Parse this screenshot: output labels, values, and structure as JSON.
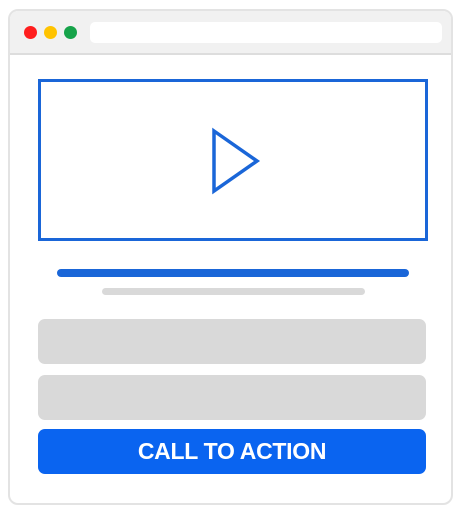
{
  "window": {
    "controls": [
      {
        "name": "close",
        "color": "#ff1e1e"
      },
      {
        "name": "minimize",
        "color": "#ffc300"
      },
      {
        "name": "maximize",
        "color": "#16a34a"
      }
    ],
    "address_bar": {
      "value": ""
    }
  },
  "video": {
    "icon": "play-icon",
    "accent_color": "#1a66d8"
  },
  "form": {
    "field_1": {
      "value": "",
      "placeholder": ""
    },
    "field_2": {
      "value": "",
      "placeholder": ""
    }
  },
  "cta": {
    "label": "CALL TO ACTION",
    "color": "#0a64f0"
  }
}
